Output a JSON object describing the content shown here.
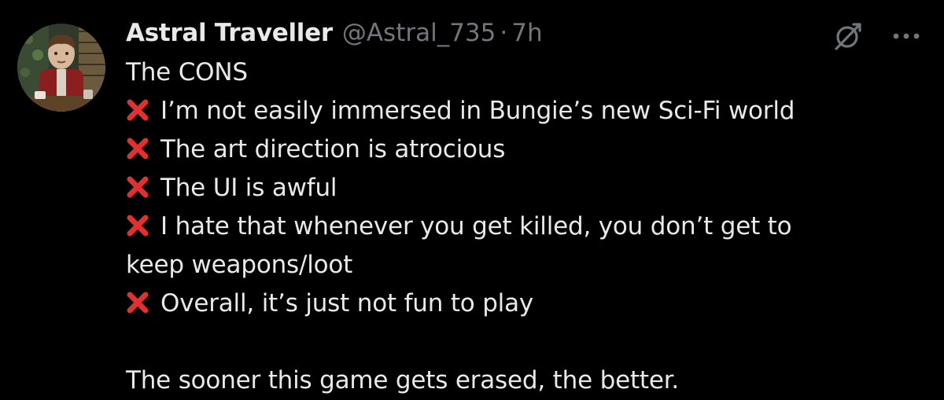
{
  "author": {
    "display_name": "Astral Traveller",
    "handle": "@Astral_735",
    "separator": "·",
    "time": "7h"
  },
  "icons": {
    "avatar": "profile-illustration",
    "grok": "grok-icon",
    "more": "more-icon",
    "cross": "cross-mark-emoji"
  },
  "colors": {
    "background": "#000000",
    "text": "#e7e9ea",
    "secondary": "#71767b",
    "cross": "#e03030"
  },
  "post": {
    "heading": "The CONS",
    "items": [
      "I’m not easily immersed in Bungie’s new Sci-Fi world",
      "The art direction is atrocious",
      "The UI is awful",
      "I hate that whenever you get killed, you don’t get to",
      "Overall, it’s just not fun to play"
    ],
    "item_continuation": "keep weapons/loot",
    "closing": "The sooner this game gets erased, the better."
  }
}
